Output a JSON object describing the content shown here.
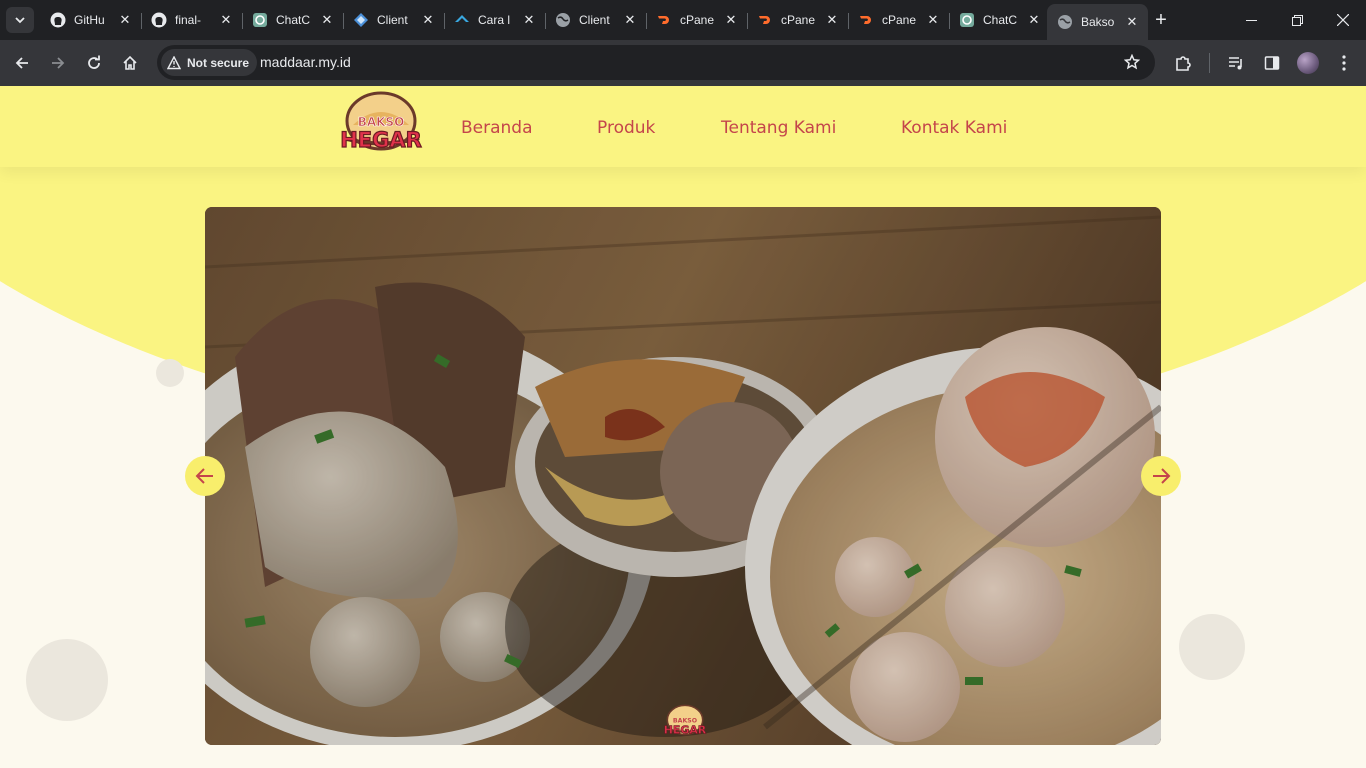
{
  "browser": {
    "tabs": [
      {
        "title": "GitHu",
        "icon": "github-icon"
      },
      {
        "title": "final-",
        "icon": "github-icon"
      },
      {
        "title": "ChatC",
        "icon": "chatgpt-icon"
      },
      {
        "title": "Client",
        "icon": "client-icon"
      },
      {
        "title": "Cara l",
        "icon": "cara-icon"
      },
      {
        "title": "Client",
        "icon": "globe-icon"
      },
      {
        "title": "cPane",
        "icon": "cpanel-icon"
      },
      {
        "title": "cPane",
        "icon": "cpanel-icon"
      },
      {
        "title": "cPane",
        "icon": "cpanel-icon"
      },
      {
        "title": "ChatC",
        "icon": "chatgpt-icon"
      },
      {
        "title": "Bakso",
        "icon": "globe-icon",
        "active": true
      }
    ],
    "security_label": "Not secure",
    "url": "maddaar.my.id"
  },
  "site": {
    "logo": {
      "line1": "BAKSO",
      "line2": "HEGAR"
    },
    "nav": [
      "Beranda",
      "Produk",
      "Tentang Kami",
      "Kontak Kami"
    ],
    "colors": {
      "accent": "#c4454b",
      "hero": "#faf482",
      "page_bg": "#fcf9ee",
      "arrow_bg": "#f8ee6c"
    }
  }
}
